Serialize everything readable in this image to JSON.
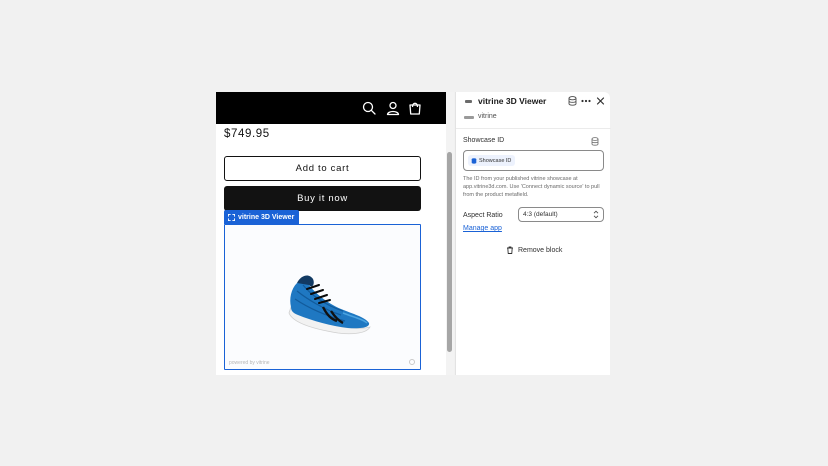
{
  "storefront": {
    "price": "$749.95",
    "add_to_cart_label": "Add to cart",
    "buy_now_label": "Buy it now",
    "block_tag_label": "vitrine 3D Viewer",
    "powered_by": "powered by vitrine"
  },
  "panel": {
    "title": "vitrine 3D Viewer",
    "subtitle": "vitrine",
    "showcase_label": "Showcase ID",
    "showcase_value": "Showcase ID",
    "help_text": "The ID from your published vitrine showcase at app.vitrine3d.com. Use 'Connect dynamic source' to pull from the product metafield.",
    "aspect_label": "Aspect Ratio",
    "aspect_value": "4:3 (default)",
    "manage_app_label": "Manage app",
    "remove_block_label": "Remove block"
  },
  "icons": {
    "header": [
      "search-icon",
      "account-icon",
      "cart-icon"
    ],
    "panel": [
      "database-icon",
      "more-icon",
      "close-icon"
    ],
    "remove": "trash-icon"
  },
  "colors": {
    "accent": "#1a62d6",
    "header_bg": "#000000",
    "buy_now_bg": "#121212",
    "canvas_bg": "#f1f1f1"
  }
}
